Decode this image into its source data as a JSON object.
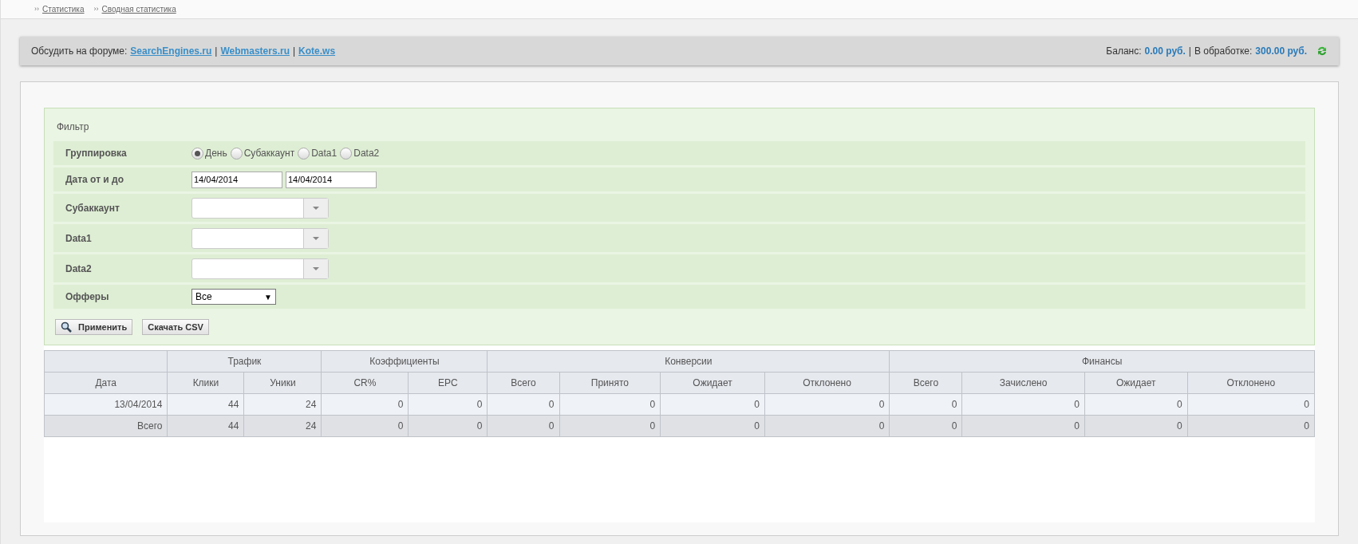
{
  "breadcrumbs": [
    {
      "sep": "››",
      "label": "Статистика"
    },
    {
      "sep": "››",
      "label": "Сводная статистика"
    }
  ],
  "forum_bar": {
    "prefix": "Обсудить на форуме:",
    "links": [
      "SearchEngines.ru",
      "Webmasters.ru",
      "Kote.ws"
    ],
    "separator": "|"
  },
  "balance": {
    "label": "Баланс:",
    "value": "0.00 руб.",
    "separator": "|",
    "processing_label": "В обработке:",
    "processing_value": "300.00 руб."
  },
  "filter": {
    "title": "Фильтр",
    "rows": [
      {
        "kind": "radio",
        "label": "Группировка",
        "options": [
          {
            "label": "День",
            "selected": true
          },
          {
            "label": "Субаккаунт",
            "selected": false
          },
          {
            "label": "Data1",
            "selected": false
          },
          {
            "label": "Data2",
            "selected": false
          }
        ]
      },
      {
        "kind": "dates",
        "label": "Дата от и до",
        "values": [
          "14/04/2014",
          "14/04/2014"
        ]
      },
      {
        "kind": "combo",
        "label": "Субаккаунт"
      },
      {
        "kind": "combo",
        "label": "Data1"
      },
      {
        "kind": "combo",
        "label": "Data2"
      },
      {
        "kind": "select",
        "label": "Офферы",
        "value": "Все",
        "arrow": "▼"
      }
    ],
    "buttons": [
      {
        "label": "Применить",
        "kind": "search"
      },
      {
        "label": "Скачать CSV",
        "kind": "plain"
      }
    ]
  },
  "table": {
    "groups": [
      {
        "columns": [
          "Дата"
        ]
      },
      {
        "label": "Трафик",
        "columns": [
          "Клики",
          "Уники"
        ]
      },
      {
        "label": "Коэффициенты",
        "columns": [
          "CR%",
          "EPC"
        ]
      },
      {
        "label": "Конверсии",
        "columns": [
          "Всего",
          "Принято",
          "Ожидает",
          "Отклонено"
        ]
      },
      {
        "label": "Финансы",
        "columns": [
          "Всего",
          "Зачислено",
          "Ожидает",
          "Отклонено"
        ]
      }
    ],
    "rows": [
      {
        "kind": "data",
        "cells": [
          "13/04/2014",
          "44",
          "24",
          "0",
          "0",
          "0",
          "0",
          "0",
          "0",
          "0",
          "0",
          "0",
          "0"
        ]
      },
      {
        "kind": "total",
        "cells": [
          "Всего",
          "44",
          "24",
          "0",
          "0",
          "0",
          "0",
          "0",
          "0",
          "0",
          "0",
          "0",
          "0"
        ]
      }
    ]
  }
}
